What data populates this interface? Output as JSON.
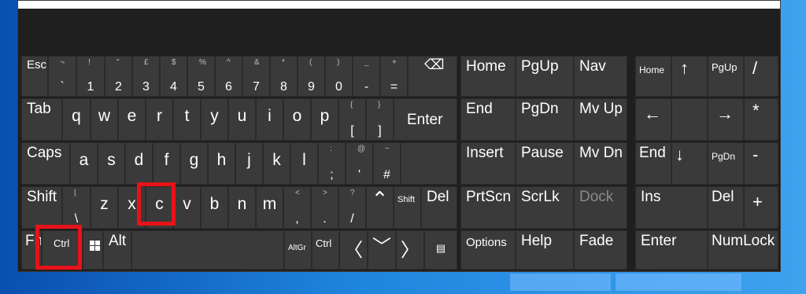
{
  "colors": {
    "keyboard_bg": "#1f1f1f",
    "key_bg": "#3a3a3a",
    "highlight": "#e8121a",
    "desktop": "#1a78d6"
  },
  "main_keys": {
    "esc": {
      "label": "Esc",
      "shift": "¬",
      "low": "`"
    },
    "d1": {
      "shift": "!",
      "low": "1"
    },
    "d2": {
      "shift": "\"",
      "low": "2"
    },
    "d3": {
      "shift": "£",
      "low": "3"
    },
    "d4": {
      "shift": "$",
      "low": "4"
    },
    "d5": {
      "shift": "%",
      "low": "5"
    },
    "d6": {
      "shift": "^",
      "low": "6"
    },
    "d7": {
      "shift": "&",
      "low": "7"
    },
    "d8": {
      "shift": "*",
      "low": "8"
    },
    "d9": {
      "shift": "(",
      "low": "9"
    },
    "d0": {
      "shift": ")",
      "low": "0"
    },
    "minus": {
      "shift": "_",
      "low": "-"
    },
    "equals": {
      "shift": "+",
      "low": "="
    },
    "backspace": {
      "icon": "backspace-icon",
      "glyph": "⌫"
    },
    "tab": "Tab",
    "q": "q",
    "w": "w",
    "e": "e",
    "r": "r",
    "t": "t",
    "y": "y",
    "u": "u",
    "i": "i",
    "o": "o",
    "p": "p",
    "lbracket": {
      "shift": "{",
      "low": "["
    },
    "rbracket": {
      "shift": "}",
      "low": "]"
    },
    "enter": "Enter",
    "caps": "Caps",
    "a": "a",
    "s": "s",
    "d": "d",
    "f": "f",
    "g": "g",
    "h": "h",
    "j": "j",
    "k": "k",
    "l": "l",
    "semicolon": {
      "shift": ":",
      "low": ";"
    },
    "quote": {
      "shift": "@",
      "low": "'"
    },
    "hash": {
      "shift": "~",
      "low": "#"
    },
    "shift_left": "Shift",
    "backslash": {
      "shift": "|",
      "low": "\\"
    },
    "z": "z",
    "x": "x",
    "c": "c",
    "v": "v",
    "b": "b",
    "n": "n",
    "m": "m",
    "comma": {
      "shift": "<",
      "low": ","
    },
    "period": {
      "shift": ">",
      "low": "."
    },
    "slash": {
      "shift": "?",
      "low": "/"
    },
    "up": {
      "icon": "up-arrow-icon",
      "glyph": "⌃"
    },
    "shift_right": "Shift",
    "del": "Del",
    "fn": "Fn",
    "ctrl_left": "Ctrl",
    "win": {
      "icon": "windows-icon"
    },
    "alt": "Alt",
    "altgr": "AltGr",
    "ctrl_right": "Ctrl",
    "left": {
      "icon": "left-arrow-icon",
      "glyph": "〈"
    },
    "down": {
      "icon": "down-arrow-icon",
      "glyph": "﹀"
    },
    "right": {
      "icon": "right-arrow-icon",
      "glyph": "〉"
    },
    "menu": {
      "icon": "context-menu-icon",
      "glyph": "▤"
    }
  },
  "nav_keys": {
    "home": "Home",
    "pgup": "PgUp",
    "nav": "Nav",
    "end": "End",
    "pgdn": "PgDn",
    "mvup": "Mv Up",
    "insert": "Insert",
    "pause": "Pause",
    "mvdn": "Mv Dn",
    "prtscn": "PrtScn",
    "scrlk": "ScrLk",
    "dock": "Dock",
    "options": "Options",
    "help": "Help",
    "fade": "Fade"
  },
  "numpad_keys": {
    "home": "Home",
    "up": "↑",
    "pgup": "PgUp",
    "divide": "/",
    "left": "←",
    "right": "→",
    "multiply": "*",
    "end": "End",
    "down": "↓",
    "pgdn": "PgDn",
    "minus": "-",
    "ins": "Ins",
    "del": "Del",
    "plus": "+",
    "enter": "Enter",
    "numlock": "NumLock"
  }
}
